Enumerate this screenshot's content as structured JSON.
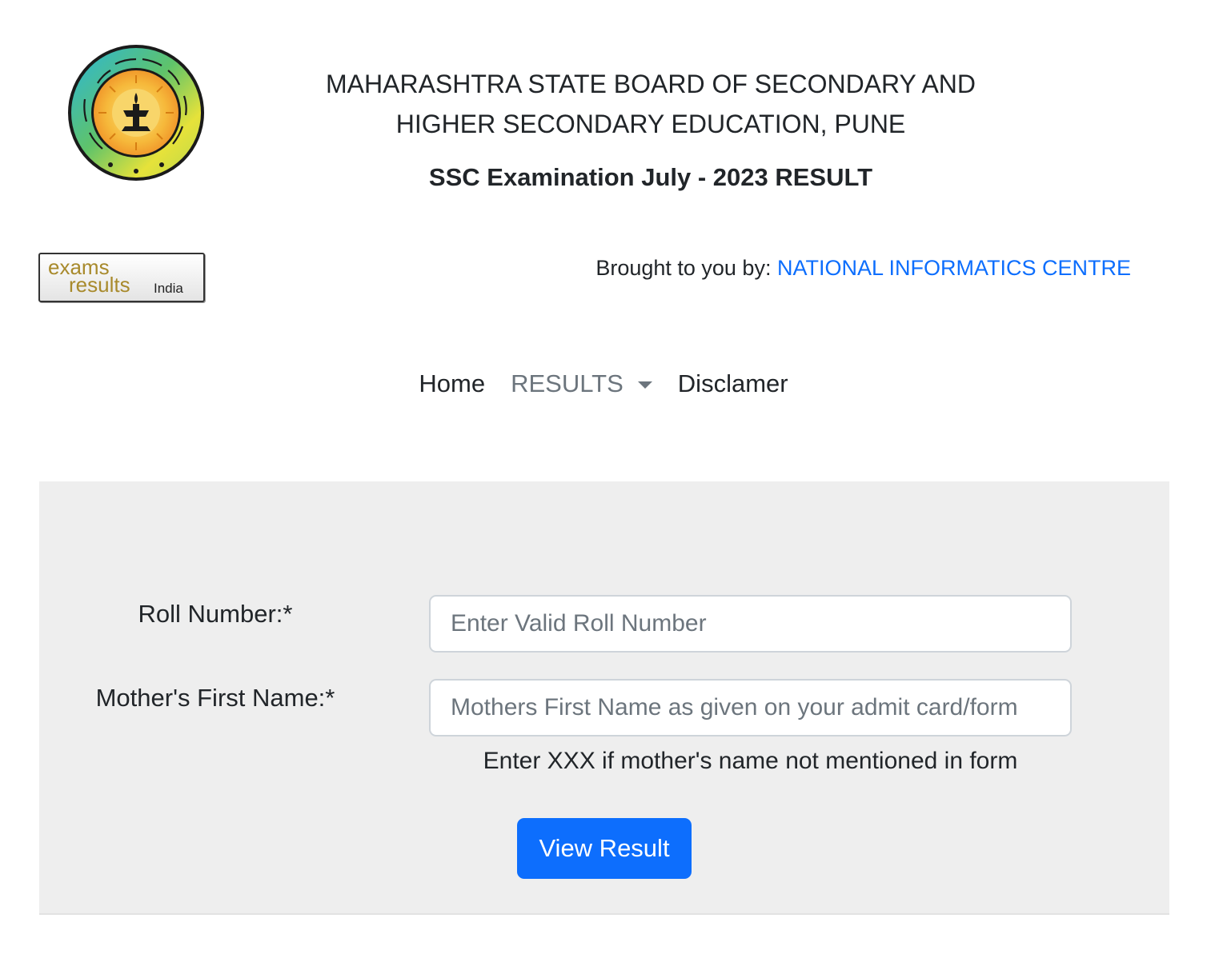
{
  "header": {
    "board_name_line1": "MAHARASHTRA STATE BOARD OF SECONDARY AND",
    "board_name_line2": "HIGHER SECONDARY EDUCATION, PUNE",
    "exam_title": "SSC Examination July - 2023 RESULT",
    "board_logo_icon": "msbshse-seal-logo",
    "exams_logo": {
      "line1": "exams",
      "line2": "results",
      "suffix": "India"
    }
  },
  "credit": {
    "prefix": "Brought to you by:",
    "link_text": "NATIONAL INFORMATICS CENTRE",
    "link_color": "#0d6efd"
  },
  "nav": {
    "home": "Home",
    "results": "RESULTS",
    "disclaimer": "Disclamer"
  },
  "form": {
    "roll_label": "Roll Number:*",
    "roll_placeholder": "Enter Valid Roll Number",
    "roll_value": "",
    "mother_label": "Mother's First Name:*",
    "mother_placeholder": "Mothers First Name as given on your admit card/form",
    "mother_value": "",
    "hint": "Enter XXX if mother's name not mentioned in form",
    "submit_label": "View Result",
    "submit_color": "#0d6efd",
    "panel_color": "#eeeeee"
  }
}
